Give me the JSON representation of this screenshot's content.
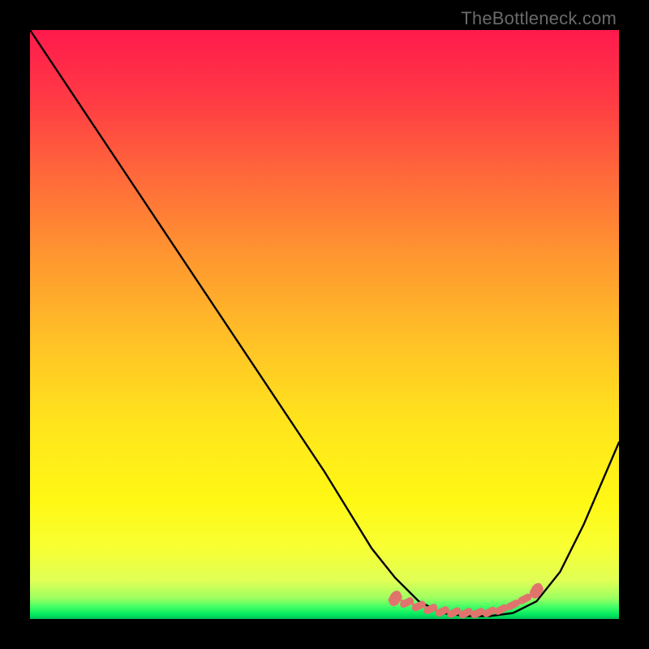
{
  "watermark": "TheBottleneck.com",
  "chart_data": {
    "type": "line",
    "title": "",
    "xlabel": "",
    "ylabel": "",
    "xlim": [
      0,
      100
    ],
    "ylim": [
      0,
      100
    ],
    "grid": false,
    "legend": false,
    "series": [
      {
        "name": "bottleneck-curve",
        "color": "#000000",
        "x": [
          0,
          10,
          20,
          30,
          40,
          50,
          58,
          62,
          66,
          70,
          74,
          78,
          82,
          86,
          90,
          94,
          100
        ],
        "y": [
          100,
          85,
          70,
          55,
          40,
          25,
          12,
          7,
          3,
          1,
          0.5,
          0.5,
          1,
          3,
          8,
          16,
          30
        ]
      },
      {
        "name": "optimal-range-markers",
        "color": "#e0746d",
        "style": "dashed-dots",
        "x": [
          62,
          64,
          66,
          68,
          70,
          72,
          74,
          76,
          78,
          80,
          82,
          84,
          86
        ],
        "y": [
          3.5,
          2.8,
          2.2,
          1.7,
          1.3,
          1.1,
          1.0,
          1.0,
          1.2,
          1.6,
          2.4,
          3.4,
          4.8
        ]
      }
    ],
    "annotations": []
  }
}
